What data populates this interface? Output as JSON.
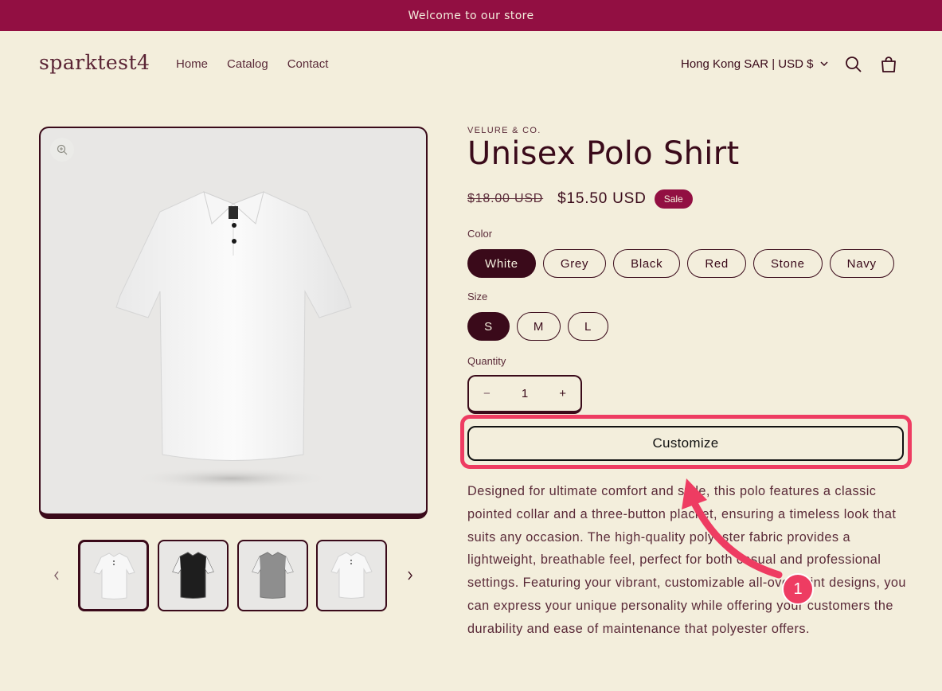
{
  "announcement": "Welcome to our store",
  "store_name": "sparktest4",
  "nav": [
    "Home",
    "Catalog",
    "Contact"
  ],
  "currency": "Hong Kong SAR | USD $",
  "product": {
    "vendor": "VELURE & CO.",
    "title": "Unisex Polo Shirt",
    "price_old": "$18.00 USD",
    "price_new": "$15.50 USD",
    "badge": "Sale",
    "color_label": "Color",
    "colors": [
      "White",
      "Grey",
      "Black",
      "Red",
      "Stone",
      "Navy"
    ],
    "selected_color": "White",
    "size_label": "Size",
    "sizes": [
      "S",
      "M",
      "L"
    ],
    "selected_size": "S",
    "quantity_label": "Quantity",
    "quantity": "1",
    "minus": "−",
    "plus": "+",
    "customize_label": "Customize",
    "description": "Designed for ultimate comfort and style, this polo features a classic pointed collar and a three-button placket, ensuring a timeless look that suits any occasion. The high-quality polyester fabric provides a lightweight, breathable feel, perfect for both casual and professional settings. Featuring your vibrant, customizable all-over print designs, you can express your unique personality while offering your customers the durability and ease of maintenance that polyester offers."
  },
  "thumbnails": [
    "white",
    "black",
    "grey",
    "white"
  ],
  "annotation_number": "1",
  "colors": {
    "accent": "#920f42",
    "dark": "#3a0a1a",
    "background": "#f3eedc",
    "annotation": "#ee3c62"
  }
}
